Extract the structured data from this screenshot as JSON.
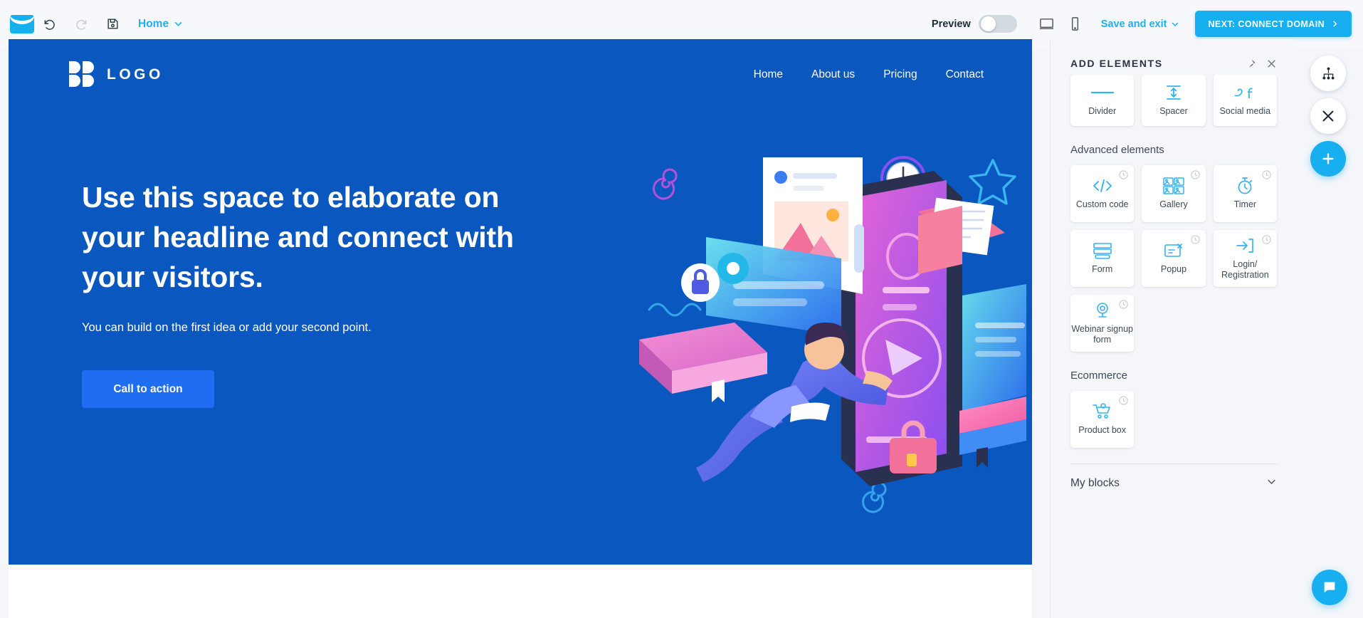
{
  "toolbar": {
    "app_logo": "mail-logo",
    "undo_label": "Undo",
    "redo_label": "Redo",
    "save_label": "Save",
    "page_selector": "Home",
    "preview_label": "Preview",
    "preview_state": "off",
    "desktop_label": "Desktop view",
    "mobile_label": "Mobile view",
    "save_and_exit": "Save and exit",
    "next_button": "NEXT: CONNECT DOMAIN",
    "accent_color": "#18aff0",
    "bar_bg": "#f6f8fc"
  },
  "site": {
    "brand": "LOGO",
    "nav": [
      {
        "label": "Home"
      },
      {
        "label": "About us"
      },
      {
        "label": "Pricing"
      },
      {
        "label": "Contact"
      }
    ],
    "hero": {
      "headline": "Use this space to elaborate on your headline and connect with your visitors.",
      "subtext": "You can build on the first idea or add your second point.",
      "cta_label": "Call to action",
      "bg_color": "#0b57c0",
      "cta_color": "#1f6df0"
    }
  },
  "panel": {
    "title": "ADD ELEMENTS",
    "pin_label": "Pin panel",
    "close_label": "Close panel",
    "basic_elements": [
      {
        "label": "Divider",
        "icon": "divider-icon",
        "locked": false
      },
      {
        "label": "Spacer",
        "icon": "spacer-icon",
        "locked": false
      },
      {
        "label": "Social media",
        "icon": "social-media-icon",
        "locked": false
      }
    ],
    "advanced_heading": "Advanced elements",
    "advanced_elements": [
      {
        "label": "Custom code",
        "icon": "code-icon",
        "locked": true
      },
      {
        "label": "Gallery",
        "icon": "gallery-icon",
        "locked": true
      },
      {
        "label": "Timer",
        "icon": "timer-icon",
        "locked": true
      },
      {
        "label": "Form",
        "icon": "form-icon",
        "locked": true
      },
      {
        "label": "Popup",
        "icon": "popup-icon",
        "locked": true
      },
      {
        "label": "Login/ Registration",
        "icon": "login-icon",
        "locked": true
      },
      {
        "label": "Webinar signup form",
        "icon": "webinar-icon",
        "locked": true
      }
    ],
    "ecommerce_heading": "Ecommerce",
    "ecommerce_elements": [
      {
        "label": "Product box",
        "icon": "cart-icon",
        "locked": true
      }
    ],
    "my_blocks_label": "My blocks"
  },
  "rail": {
    "sitemap_label": "Site map",
    "close_label": "Close",
    "add_label": "Add",
    "chat_label": "Chat support"
  }
}
